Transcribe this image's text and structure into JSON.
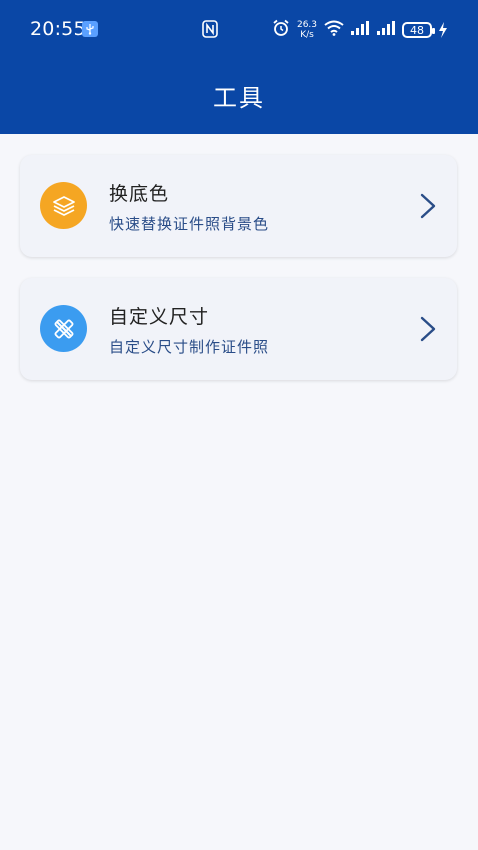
{
  "status_bar": {
    "time": "20:55",
    "network_speed_value": "26.3",
    "network_speed_unit": "K/s",
    "battery_level": "48"
  },
  "header": {
    "title": "工具"
  },
  "tools": [
    {
      "title": "换底色",
      "subtitle": "快速替换证件照背景色",
      "icon": "layers-icon",
      "icon_color": "#f5a623"
    },
    {
      "title": "自定义尺寸",
      "subtitle": "自定义尺寸制作证件照",
      "icon": "ruler-pencil-icon",
      "icon_color": "#3b9cf0"
    }
  ],
  "colors": {
    "header_bg": "#0a47a6",
    "page_bg": "#f6f7fb",
    "card_bg": "#f1f3f9",
    "subtitle_text": "#2a4d88"
  }
}
